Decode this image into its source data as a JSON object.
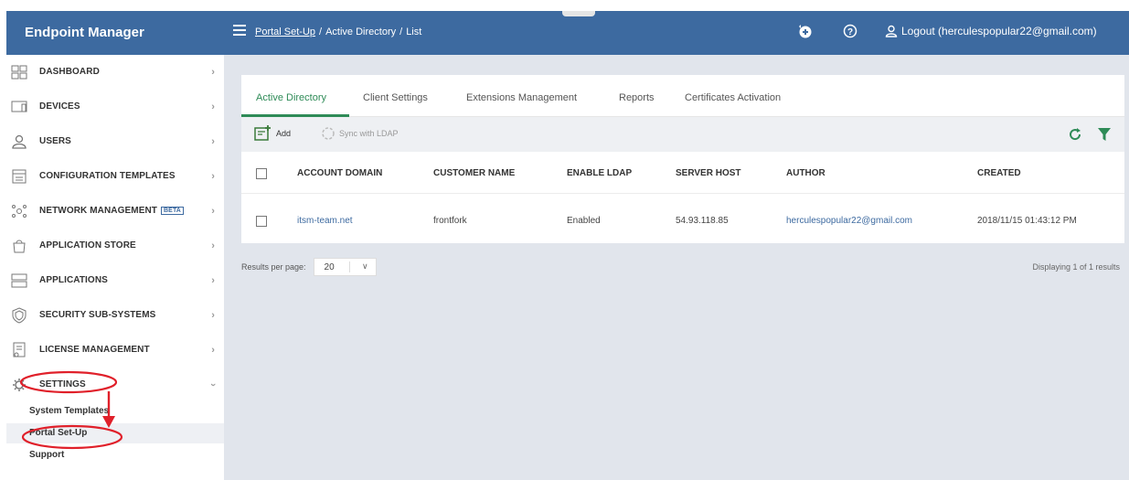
{
  "brand": {
    "title": "Endpoint Manager"
  },
  "header": {
    "breadcrumb": [
      "Portal Set-Up",
      "Active Directory",
      "List"
    ],
    "logout_label": "Logout (herculespopular22@gmail.com)"
  },
  "sidebar": {
    "items": [
      {
        "label": "DASHBOARD",
        "icon": "dashboard-icon"
      },
      {
        "label": "DEVICES",
        "icon": "devices-icon"
      },
      {
        "label": "USERS",
        "icon": "users-icon"
      },
      {
        "label": "CONFIGURATION TEMPLATES",
        "icon": "templates-icon"
      },
      {
        "label": "NETWORK MANAGEMENT",
        "icon": "network-icon",
        "badge": "BETA"
      },
      {
        "label": "APPLICATION STORE",
        "icon": "store-icon"
      },
      {
        "label": "APPLICATIONS",
        "icon": "applications-icon"
      },
      {
        "label": "SECURITY SUB-SYSTEMS",
        "icon": "shield-icon"
      },
      {
        "label": "LICENSE MANAGEMENT",
        "icon": "license-icon"
      },
      {
        "label": "SETTINGS",
        "icon": "gear-icon"
      }
    ],
    "settings_sub": [
      {
        "label": "System Templates"
      },
      {
        "label": "Portal Set-Up",
        "active": true
      },
      {
        "label": "Support"
      }
    ]
  },
  "tabs": [
    {
      "label": "Active Directory",
      "active": true
    },
    {
      "label": "Client Settings"
    },
    {
      "label": "Extensions Management"
    },
    {
      "label": "Reports"
    },
    {
      "label": "Certificates Activation"
    }
  ],
  "toolbar": {
    "add_label": "Add",
    "sync_label": "Sync with LDAP"
  },
  "table": {
    "columns": [
      "ACCOUNT DOMAIN",
      "CUSTOMER NAME",
      "ENABLE LDAP",
      "SERVER HOST",
      "AUTHOR",
      "CREATED"
    ],
    "rows": [
      [
        "itsm-team.net",
        "frontfork",
        "Enabled",
        "54.93.118.85",
        "herculespopular22@gmail.com",
        "2018/11/15 01:43:12 PM"
      ]
    ]
  },
  "pagination": {
    "results_per_page_label": "Results per page:",
    "per_page_value": "20",
    "summary": "Displaying 1 of 1 results"
  },
  "colors": {
    "header_bg": "#3d6aa0",
    "accent_green": "#2e8b57",
    "annotation_red": "#e0202a",
    "link_blue": "#3d6aa0"
  }
}
